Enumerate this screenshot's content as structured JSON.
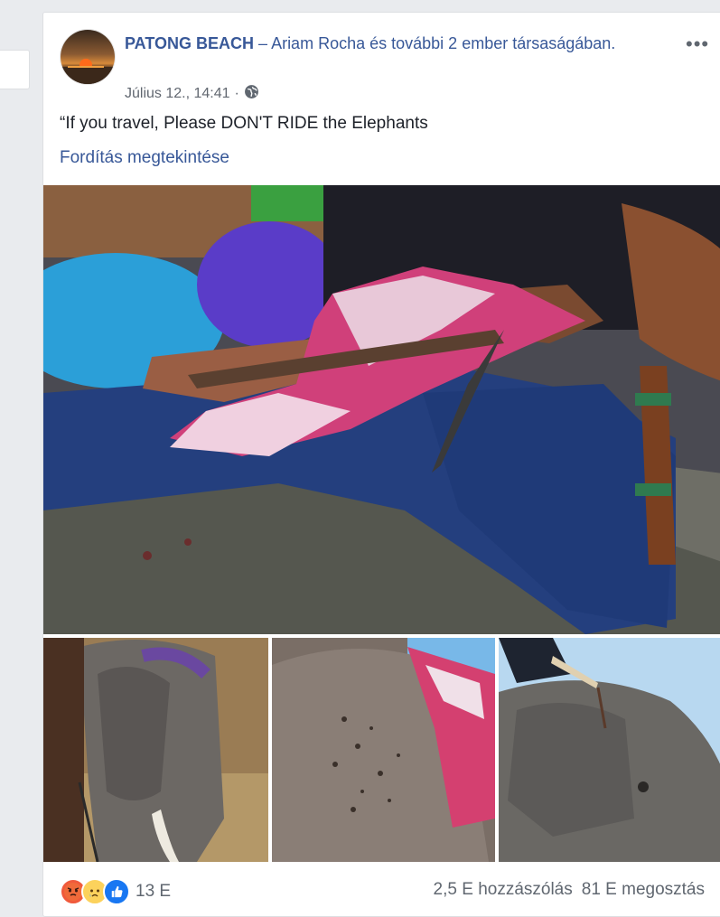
{
  "post": {
    "page_name": "PATONG BEACH",
    "dash": "–",
    "with_user": "Ariam Rocha",
    "with_rest": "és további 2 ember társaságában.",
    "timestamp": "Július 12., 14:41",
    "separator": "·",
    "audience_icon": "globe-icon",
    "more_icon": "•••",
    "text": "“If you travel, Please DON'T RIDE the Elephants",
    "translate_label": "Fordítás megtekintése"
  },
  "footer": {
    "reaction_icons": [
      "angry-icon",
      "sad-icon",
      "like-icon"
    ],
    "reaction_count": "13 E",
    "comments": "2,5 E hozzászólás",
    "shares": "81 E megosztás"
  },
  "colors": {
    "link": "#385898",
    "text": "#1d2129",
    "meta": "#616770",
    "background": "#e9ebee"
  }
}
